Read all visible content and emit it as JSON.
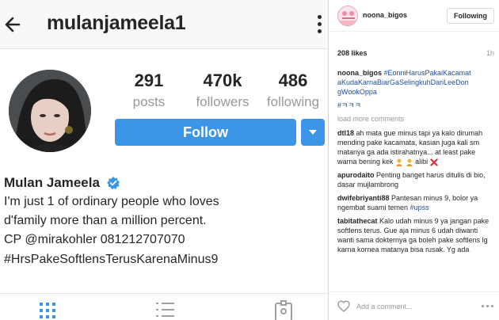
{
  "profile": {
    "username": "mulanjameela1",
    "stats": [
      {
        "value": "291",
        "label": "posts"
      },
      {
        "value": "470k",
        "label": "followers"
      },
      {
        "value": "486",
        "label": "following"
      }
    ],
    "follow_label": "Follow",
    "accent_color": "#3d95e8",
    "bio": {
      "name": "Mulan Jameela",
      "lines": [
        "I'm just 1 of ordinary people who loves",
        "d'family more than a million percent.",
        "CP @mirakohler 081212707070",
        "#HrsPakeSoftlensTerusKarenaMinus9"
      ]
    },
    "tabs": [
      "grid-icon",
      "list-icon",
      "tagged-icon"
    ]
  },
  "post": {
    "username": "noona_bigos",
    "following_label": "Following",
    "likes": "208 likes",
    "time": "1h",
    "caption": {
      "user": "noona_bigos",
      "tag": "#EonniHarusPakaiKacamat aKudaKarnaBiarGaSelingkuhDariLeeDon gWookOppa",
      "extra": "#ㅋㅋㅋ"
    },
    "load_more": "load more comments",
    "comments": [
      {
        "user": "dtl18",
        "text": "ah mata gue minus tapi ya kalo dirumah mending pake kacamata, kasian juga kali sm matanya ga ada istirahatnya... at least pake warna bening kek",
        "extra": "alibi",
        "emoji": [
          "person-shrug-icon",
          "person-shrug-icon",
          "cross-mark-icon"
        ]
      },
      {
        "user": "apurodaito",
        "text": "Penting banget harus ditulis di bio, dasar mujlambrong"
      },
      {
        "user": "dwifebriyanti88",
        "text": "Pantesan minus 9, bolor ya ngembat suami temen",
        "tag": "#upss"
      },
      {
        "user": "tabitathecat",
        "text": "Kalo udah minus 9 ya jangan pake softlens terus. Gue aja minus 6 udah diwanti wanti sama dokternya ga boleh pake softlens lg karna kornea matanya bisa rusak. Yg ada"
      }
    ],
    "comment_placeholder": "Add a comment..."
  }
}
